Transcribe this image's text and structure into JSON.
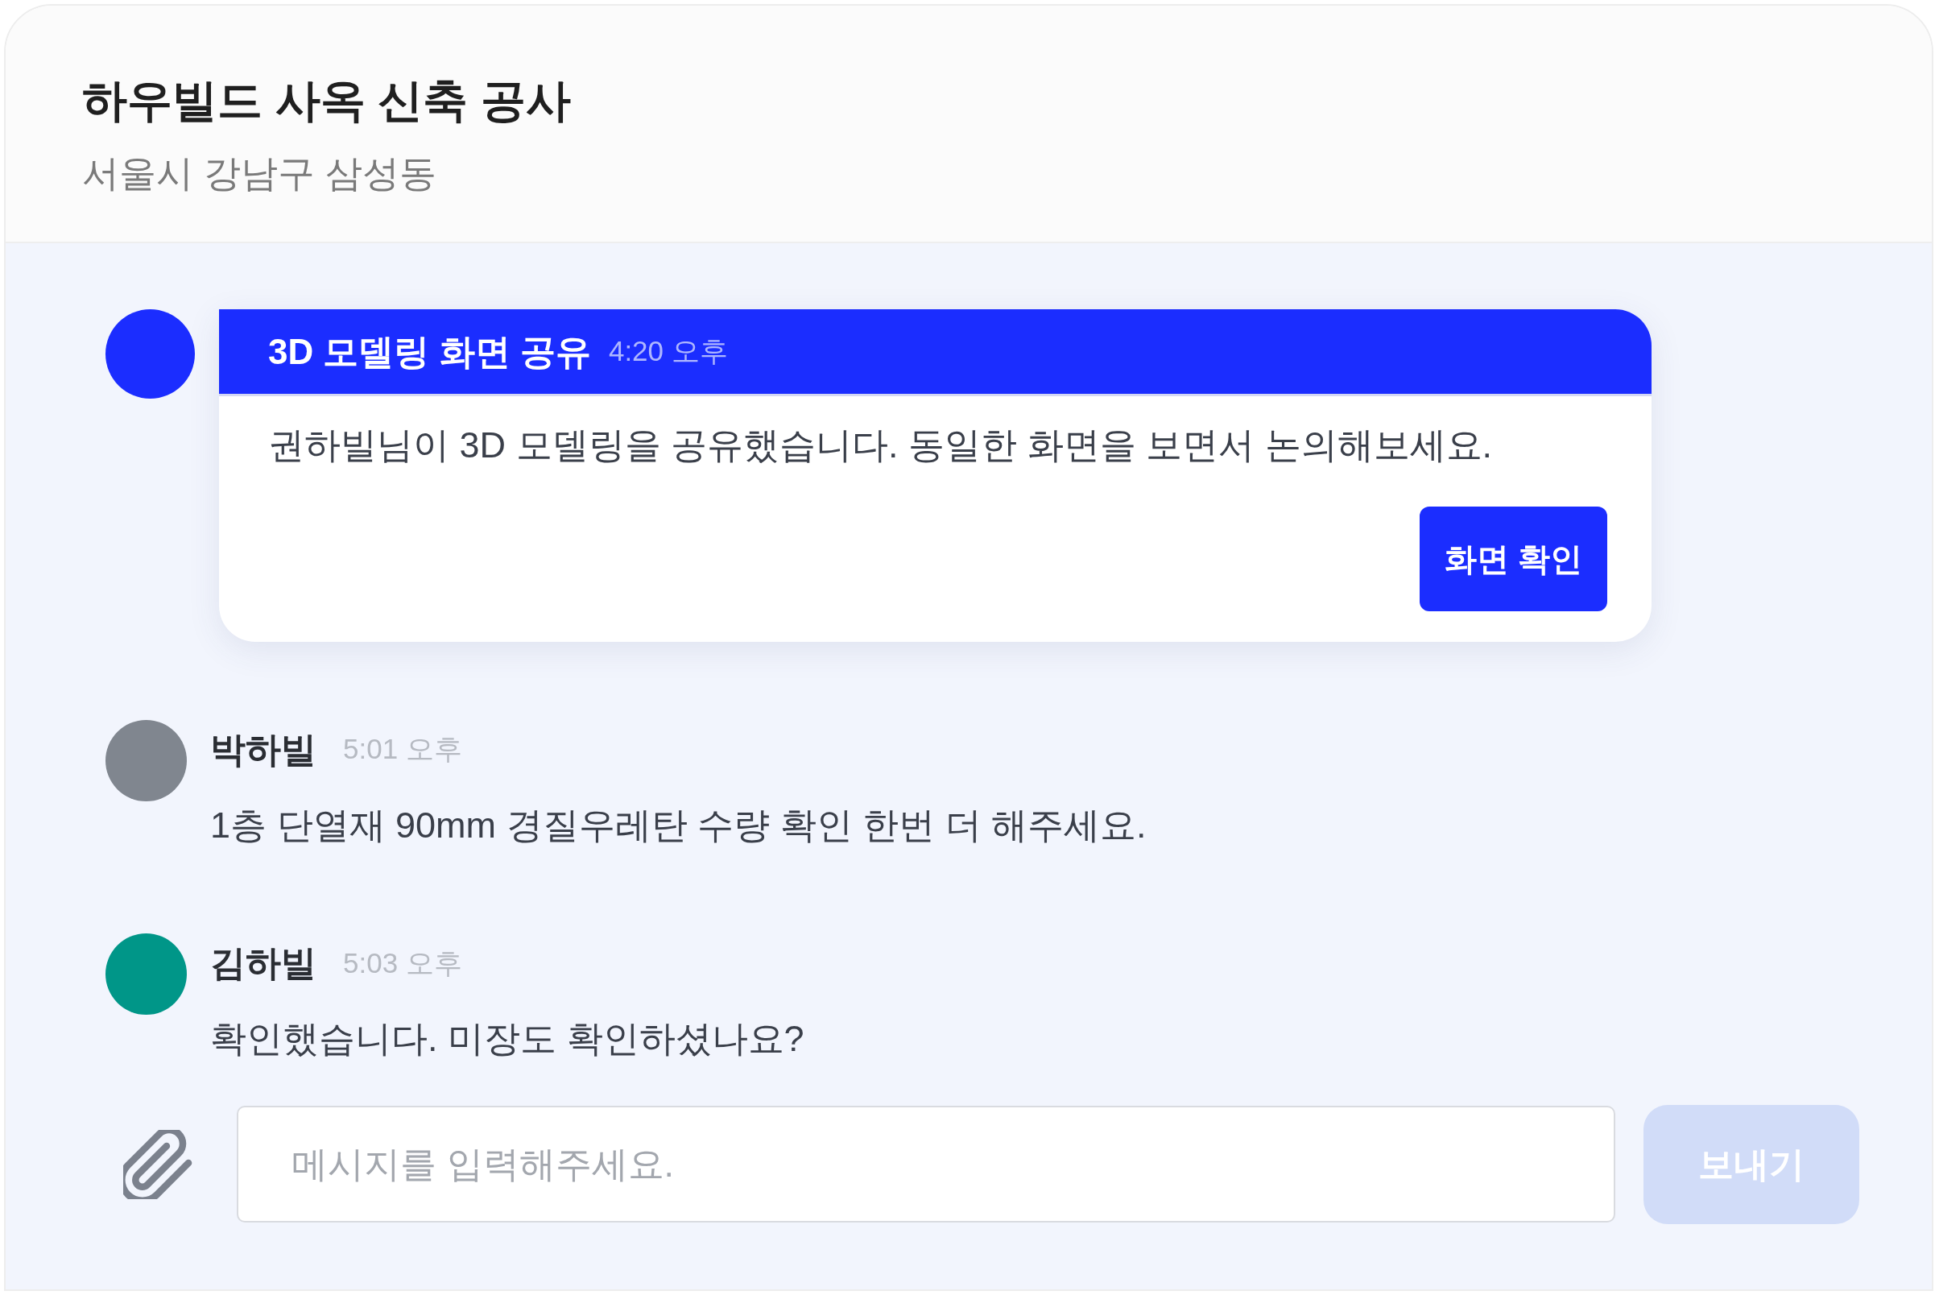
{
  "project": {
    "title": "하우빌드 사옥 신축 공사",
    "location": "서울시 강남구 삼성동"
  },
  "messages": [
    {
      "kind": "share",
      "color": "#1b2dff",
      "title": "3D 모델링 화면 공유",
      "time": "4:20 오후",
      "text": "권하빌님이 3D 모델링을 공유했습니다. 동일한 화면을 보면서 논의해보세요.",
      "action": "화면 확인"
    },
    {
      "kind": "text",
      "color": "#80868f",
      "sender": "박하빌",
      "time": "5:01 오후",
      "text": "1층 단열재 90mm 경질우레탄 수량 확인 한번 더 해주세요."
    },
    {
      "kind": "text",
      "color": "#009688",
      "sender": "김하빌",
      "time": "5:03 오후",
      "text": "확인했습니다. 미장도 확인하셨나요?"
    }
  ],
  "composer": {
    "placeholder": "메시지를 입력해주세요.",
    "send_button": {
      "label": "보내기",
      "disabled": true
    }
  }
}
